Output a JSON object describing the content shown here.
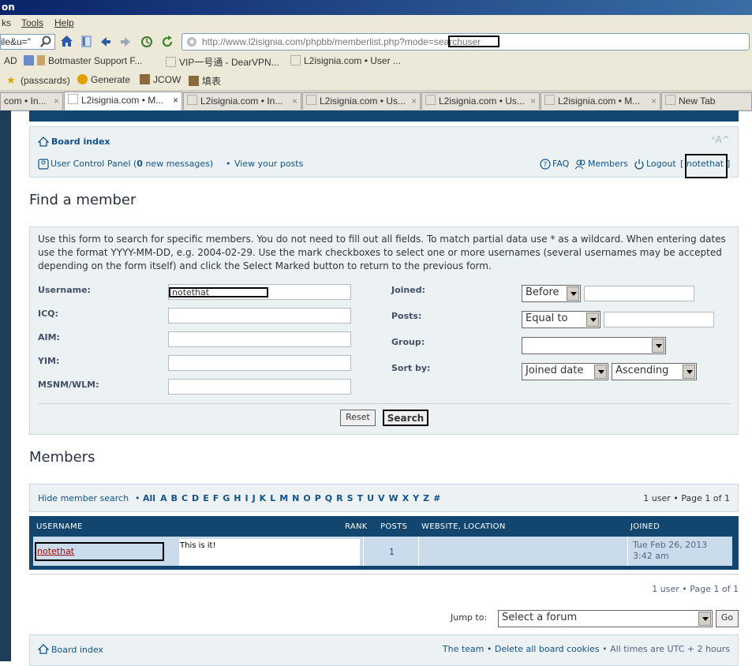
{
  "browser": {
    "title": "on",
    "menu": [
      "ks",
      "Tools",
      "Help"
    ],
    "search_fragment": "ile&u=\"",
    "url": "http://www.l2isignia.com/phpbb/memberlist.php?mode=searchuser",
    "bookmarks_row1": [
      "AD",
      "Botmaster Support F...",
      "VIP一号通 - DearVPN...",
      "L2isignia.com • User ..."
    ],
    "bookmarks_row2": [
      "(passcards)",
      "Generate",
      "JCOW",
      "填表"
    ],
    "tabs": [
      {
        "label": "com • In...",
        "close": "×"
      },
      {
        "label": "L2isignia.com • M...",
        "close": "×"
      },
      {
        "label": "L2isignia.com • In...",
        "close": "×"
      },
      {
        "label": "L2isignia.com • Us...",
        "close": "×"
      },
      {
        "label": "L2isignia.com • Us...",
        "close": "×"
      },
      {
        "label": "L2isignia.com • M...",
        "close": "×"
      },
      {
        "label": "New Tab",
        "close": ""
      }
    ]
  },
  "nav": {
    "board_index": "Board index",
    "ucp_prefix": "User Control Panel (",
    "ucp_count": "0",
    "ucp_suffix": " new messages)",
    "sep": "•",
    "view_posts": "View your posts",
    "faq": "FAQ",
    "members": "Members",
    "logout": "Logout",
    "bracket_open": "[",
    "username": "notethat",
    "bracket_close": "]"
  },
  "find": {
    "heading": "Find a member",
    "intro": "Use this form to search for specific members. You do not need to fill out all fields. To match partial data use * as a wildcard. When entering dates use the format YYYY-MM-DD, e.g. 2004-02-29. Use the mark checkboxes to select one or more usernames (several usernames may be accepted depending on the form itself) and click the Select Marked button to return to the previous form.",
    "username_label": "Username:",
    "username_value": "notethat",
    "icq_label": "ICQ:",
    "aim_label": "AIM:",
    "yim_label": "YIM:",
    "msnm_label": "MSNM/WLM:",
    "joined_label": "Joined:",
    "joined_select": "Before",
    "posts_label": "Posts:",
    "posts_select": "Equal to",
    "group_label": "Group:",
    "group_select": "",
    "sort_label": "Sort by:",
    "sort_select": "Joined date",
    "order_select": "Ascending",
    "reset": "Reset",
    "search": "Search"
  },
  "members": {
    "heading": "Members",
    "hide_search": "Hide member search",
    "letters": [
      "All",
      "A",
      "B",
      "C",
      "D",
      "E",
      "F",
      "G",
      "H",
      "I",
      "J",
      "K",
      "L",
      "M",
      "N",
      "O",
      "P",
      "Q",
      "R",
      "S",
      "T",
      "U",
      "V",
      "W",
      "X",
      "Y",
      "Z",
      "#"
    ],
    "pagination": "1 user • Page 1 of 1",
    "columns": {
      "username": "USERNAME",
      "rank": "RANK",
      "posts": "POSTS",
      "website": "WEBSITE, LOCATION",
      "joined": "JOINED"
    },
    "rows": [
      {
        "username": "notethat",
        "rank": "This is it!",
        "posts": "1",
        "website": "",
        "joined_line1": "Tue Feb 26, 2013",
        "joined_line2": "3:42 am"
      }
    ],
    "pagination_bottom": "1 user • Page 1 of 1",
    "jump_label": "Jump to:",
    "jump_select": "Select a forum",
    "go": "Go"
  },
  "footer": {
    "board_index": "Board index",
    "team": "The team",
    "delete_cookies": "Delete all board cookies",
    "times": "All times are UTC + 2 hours"
  },
  "colors": {
    "accent": "#105289",
    "header": "#12466f",
    "row": "#cadceb",
    "panel": "#ecf1f3"
  }
}
